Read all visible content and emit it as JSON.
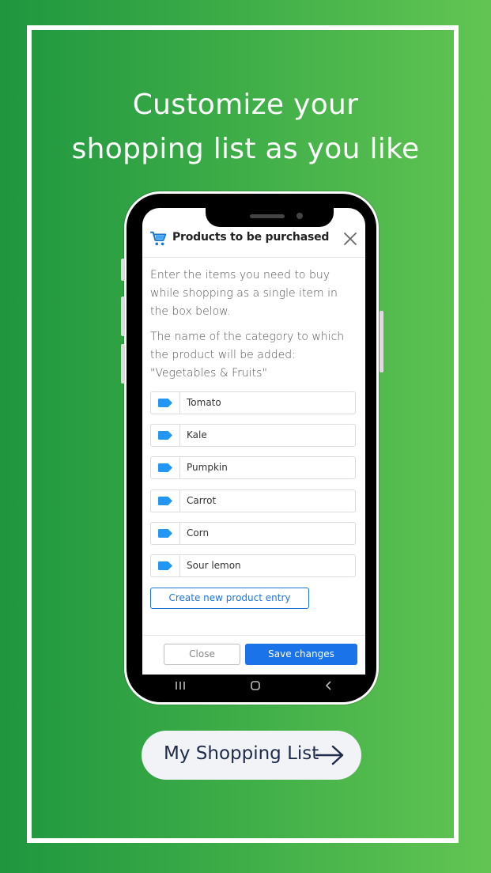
{
  "headline": {
    "line1": "Customize your",
    "line2": "shopping list as you like"
  },
  "dialog": {
    "title": "Products to be purchased",
    "icon": "shopping-cart-icon",
    "instruction": "Enter the items you need to buy while shopping as a single item in the box below.",
    "category_note": "The name of the category to which the product will be added: \"Vegetables & Fruits\"",
    "items": [
      {
        "value": "Tomato"
      },
      {
        "value": "Kale"
      },
      {
        "value": "Pumpkin"
      },
      {
        "value": "Carrot"
      },
      {
        "value": "Corn"
      },
      {
        "value": "Sour lemon"
      }
    ],
    "create_label": "Create new product entry",
    "close_label": "Close",
    "save_label": "Save changes"
  },
  "cta": {
    "label": "My Shopping List",
    "icon": "arrow-right-icon"
  },
  "colors": {
    "accent": "#1a73e8",
    "tag": "#2196f3",
    "bg_start": "#1f963f",
    "bg_end": "#62c553"
  }
}
